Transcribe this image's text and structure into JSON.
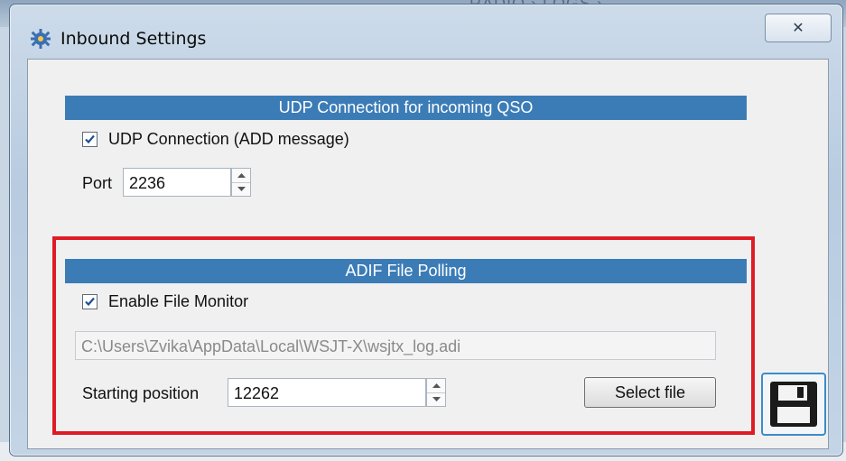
{
  "background": {
    "breadcrumb": "RADIO  ›  LOGS  ›"
  },
  "window": {
    "title": "Inbound Settings",
    "close_glyph": "✕",
    "accent": "#3b7cb7",
    "highlight_color": "#e01b24"
  },
  "udp": {
    "header": "UDP Connection for incoming QSO",
    "checkbox_label": "UDP Connection (ADD message)",
    "checked": true,
    "port_label": "Port",
    "port_value": "2236"
  },
  "adif": {
    "header": "ADIF File Polling",
    "checkbox_label": "Enable File Monitor",
    "checked": true,
    "file_path": "C:\\Users\\Zvika\\AppData\\Local\\WSJT-X\\wsjtx_log.adi",
    "starting_position_label": "Starting position",
    "starting_position_value": "12262",
    "select_file_label": "Select file"
  },
  "icons": {
    "title": "gear-icon",
    "save": "floppy-disk-icon"
  }
}
